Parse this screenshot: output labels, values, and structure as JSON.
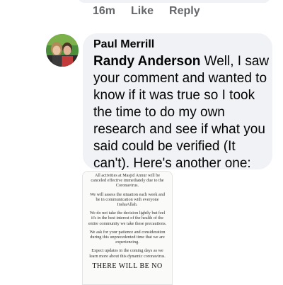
{
  "prev_comment": {
    "time": "16m",
    "like_label": "Like",
    "reply_label": "Reply"
  },
  "comment": {
    "author": "Paul Merrill",
    "mention": "Randy Anderson",
    "text_lines": [
      " Well, I saw",
      "your comment and wanted to",
      "know if it was true so I took",
      "the time to do my own",
      "research and see if what you",
      "said  could be verified (It",
      "can't). Here's another one:"
    ]
  },
  "attachment": {
    "paragraphs": [
      "All activities at Masjid Annur will be canceled effective immediately due to the Coronavirus.",
      "We will assess the situation each week and be in communication with everyone InshaAllah.",
      "We do not take the decision lightly but feel it's in the best interest of the health of the entire community we take these precautions.",
      "We ask for your patience and consideration during this unprecedented time that we are experiencing.",
      "Expect updates in the coming days as we learn more about this dynamic coronavirus."
    ],
    "heading": "THERE WILL BE NO"
  }
}
